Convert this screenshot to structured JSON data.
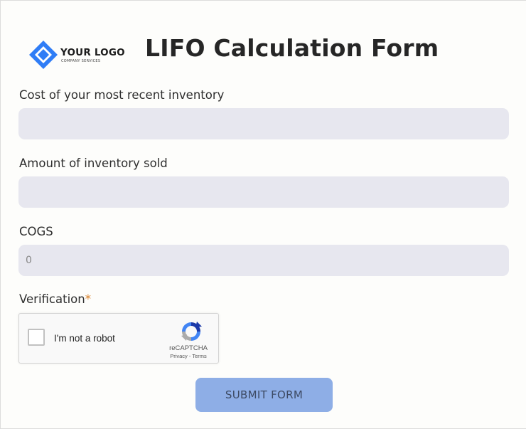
{
  "header": {
    "logo_text": "YOUR LOGO",
    "logo_subtext": "COMPANY SERVICES",
    "title": "LIFO Calculation Form"
  },
  "form": {
    "fields": [
      {
        "label": "Cost of your most recent inventory",
        "value": ""
      },
      {
        "label": "Amount of inventory sold",
        "value": ""
      },
      {
        "label": "COGS",
        "value": "0"
      }
    ],
    "verification": {
      "label": "Verification",
      "required_marker": "*"
    },
    "recaptcha": {
      "checkbox_label": "I'm not a robot",
      "brand": "reCAPTCHA",
      "privacy": "Privacy",
      "separator": " - ",
      "terms": "Terms"
    },
    "submit_label": "SUBMIT FORM"
  },
  "colors": {
    "background": "#fdfdfb",
    "field_background": "#e7e7ef",
    "submit_background": "#8eaee6",
    "logo_blue": "#2f7df6",
    "required": "#d9822b"
  },
  "icons": [
    "logo-diamond-icon",
    "recaptcha-icon"
  ]
}
